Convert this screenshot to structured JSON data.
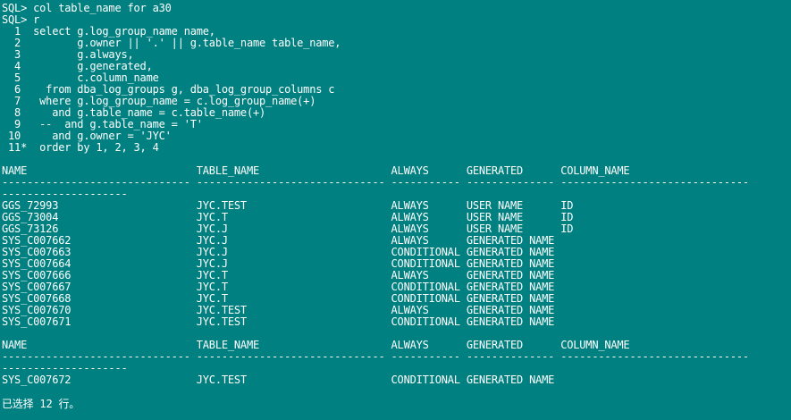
{
  "terminal": {
    "colors": {
      "background": "#008080",
      "foreground": "#ffffff"
    },
    "lines": [
      "SQL> col table_name for a30",
      "SQL> r",
      "  1  select g.log_group_name name,",
      "  2         g.owner || '.' || g.table_name table_name,",
      "  3         g.always,",
      "  4         g.generated,",
      "  5         c.column_name",
      "  6    from dba_log_groups g, dba_log_group_columns c",
      "  7   where g.log_group_name = c.log_group_name(+)",
      "  8     and g.table_name = c.table_name(+)",
      "  9   --  and g.table_name = 'T'",
      " 10     and g.owner = 'JYC'",
      " 11*  order by 1, 2, 3, 4",
      "",
      "NAME                           TABLE_NAME                     ALWAYS      GENERATED      COLUMN_NAME",
      "------------------------------ ------------------------------ ----------- -------------- ------------------------------",
      "--------------------",
      "GGS_72993                      JYC.TEST                       ALWAYS      USER NAME      ID",
      "GGS_73004                      JYC.T                          ALWAYS      USER NAME      ID",
      "GGS_73126                      JYC.J                          ALWAYS      USER NAME      ID",
      "SYS_C007662                    JYC.J                          ALWAYS      GENERATED NAME",
      "SYS_C007663                    JYC.J                          CONDITIONAL GENERATED NAME",
      "SYS_C007664                    JYC.J                          CONDITIONAL GENERATED NAME",
      "SYS_C007666                    JYC.T                          ALWAYS      GENERATED NAME",
      "SYS_C007667                    JYC.T                          CONDITIONAL GENERATED NAME",
      "SYS_C007668                    JYC.T                          CONDITIONAL GENERATED NAME",
      "SYS_C007670                    JYC.TEST                       ALWAYS      GENERATED NAME",
      "SYS_C007671                    JYC.TEST                       CONDITIONAL GENERATED NAME",
      "",
      "NAME                           TABLE_NAME                     ALWAYS      GENERATED      COLUMN_NAME",
      "------------------------------ ------------------------------ ----------- -------------- ------------------------------",
      "--------------------",
      "SYS_C007672                    JYC.TEST                       CONDITIONAL GENERATED NAME",
      "",
      "已选择 12 行。"
    ]
  }
}
